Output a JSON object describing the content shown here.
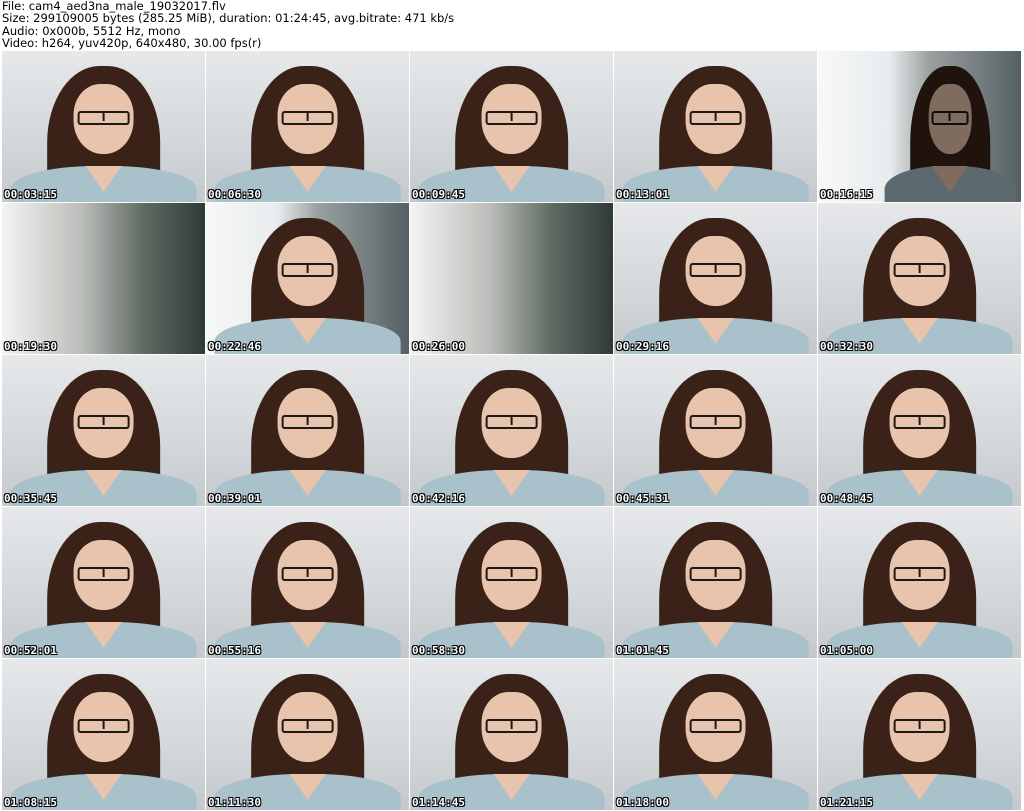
{
  "header": {
    "file": "File: cam4_aed3na_male_19032017.flv",
    "size": "Size: 299109005 bytes (285.25 MiB), duration: 01:24:45, avg.bitrate: 471 kb/s",
    "audio": "Audio: 0x000b, 5512 Hz, mono",
    "video": "Video: h264, yuv420p, 640x480, 30.00 fps(r)"
  },
  "thumbnails": [
    {
      "time": "00:03:15",
      "scene": "person"
    },
    {
      "time": "00:06:30",
      "scene": "person"
    },
    {
      "time": "00:09:45",
      "scene": "person"
    },
    {
      "time": "00:13:01",
      "scene": "person"
    },
    {
      "time": "00:16:15",
      "scene": "person-dark"
    },
    {
      "time": "00:19:30",
      "scene": "room"
    },
    {
      "time": "00:22:46",
      "scene": "person-window"
    },
    {
      "time": "00:26:00",
      "scene": "room"
    },
    {
      "time": "00:29:16",
      "scene": "person"
    },
    {
      "time": "00:32:30",
      "scene": "person"
    },
    {
      "time": "00:35:45",
      "scene": "person"
    },
    {
      "time": "00:39:01",
      "scene": "person"
    },
    {
      "time": "00:42:16",
      "scene": "person"
    },
    {
      "time": "00:45:31",
      "scene": "person"
    },
    {
      "time": "00:48:45",
      "scene": "person"
    },
    {
      "time": "00:52:01",
      "scene": "person"
    },
    {
      "time": "00:55:16",
      "scene": "person"
    },
    {
      "time": "00:58:30",
      "scene": "person"
    },
    {
      "time": "01:01:45",
      "scene": "person"
    },
    {
      "time": "01:05:00",
      "scene": "person"
    },
    {
      "time": "01:08:15",
      "scene": "person"
    },
    {
      "time": "01:11:30",
      "scene": "person"
    },
    {
      "time": "01:14:45",
      "scene": "person"
    },
    {
      "time": "01:18:00",
      "scene": "person"
    },
    {
      "time": "01:21:15",
      "scene": "person"
    }
  ]
}
